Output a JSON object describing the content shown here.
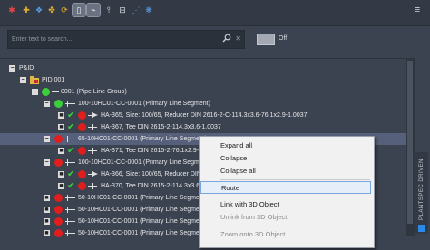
{
  "toolbar": {
    "buttons": [
      {
        "name": "tree-filter-button-1",
        "icon": "funnel-red-icon",
        "color": "#e64545"
      },
      {
        "name": "tree-filter-button-2",
        "icon": "nodes-colored-icon",
        "color": "#e0b030"
      },
      {
        "name": "tree-filter-button-3",
        "icon": "hierarchy-icon",
        "color": "#5aa0e8"
      },
      {
        "name": "tree-filter-button-4",
        "icon": "node-link-icon",
        "color": "#e0b030"
      },
      {
        "name": "refresh-button",
        "icon": "refresh-icon",
        "color": "#e0b030"
      },
      {
        "name": "view-mode-button-1",
        "icon": "column-icon",
        "color": "#d8dbe0"
      },
      {
        "name": "view-mode-button-2",
        "icon": "line-icon",
        "color": "#d8dbe0"
      },
      {
        "name": "pin-button",
        "icon": "pin-icon",
        "color": "#d8dbe0"
      },
      {
        "name": "expand-tree-button",
        "icon": "tree-expand-icon",
        "color": "#d8dbe0"
      },
      {
        "name": "share-button",
        "icon": "share-icon",
        "color": "#5aa0e8"
      },
      {
        "name": "network-button",
        "icon": "network-icon",
        "color": "#5aa0e8"
      }
    ],
    "menu_glyph": "≡"
  },
  "search": {
    "placeholder": "Enter text to search...",
    "value": "",
    "clear_glyph": "✕"
  },
  "toggle": {
    "label": "Off"
  },
  "tree": {
    "rows": [
      {
        "label": "P&ID",
        "expander": "−",
        "icon": "none"
      },
      {
        "label": "PID 001",
        "expander": "−",
        "icon": "folder-icon"
      },
      {
        "label": "0001 (Pipe Line Group)",
        "expander": "−",
        "icon": "green-dot"
      },
      {
        "label": "100-10HC01-CC-0001 (Primary Line Segment)",
        "expander": "−",
        "icon": "green-dot"
      },
      {
        "label": "HA-365, Size: 100/65, Reducer DIN 2616-2-C-114.3x3.6-76.1x2.9-1.0037",
        "expander": "■",
        "icon": "check-red"
      },
      {
        "label": "HA-367, Tee DIN 2615-2-114.3x3.6-1.0037",
        "expander": "■",
        "icon": "check-red"
      },
      {
        "label": "65-10HC01-CC-0001 (Primary Line Segment)",
        "expander": "−",
        "icon": "red-dot",
        "selected": true
      },
      {
        "label": "HA-371, Tee DIN 2615-2-76.1x2.9-1.0037",
        "expander": "■",
        "icon": "check-red"
      },
      {
        "label": "100-10HC01-CC-0001 (Primary Line Segment)",
        "expander": "−",
        "icon": "red-dot"
      },
      {
        "label": "HA-366, Size: 100/65, Reducer DIN 2616-2-C-114.3x3.6-76.1x2.9-1.0037",
        "expander": "■",
        "icon": "check-red"
      },
      {
        "label": "HA-370, Tee DIN 2615-2-114.3x3.6-1.0037",
        "expander": "■",
        "icon": "check-red"
      },
      {
        "label": "50-10HC01-CC-0001 (Primary Line Segment)",
        "expander": "■",
        "icon": "red-dot"
      },
      {
        "label": "50-10HC01-CC-0001 (Primary Line Segment)",
        "expander": "■",
        "icon": "red-dot"
      },
      {
        "label": "50-10HC01-CC-0001 (Primary Line Segment)",
        "expander": "■",
        "icon": "red-dot"
      },
      {
        "label": "50-10HC01-CC-0001 (Primary Line Segment)",
        "expander": "■",
        "icon": "red-dot"
      }
    ]
  },
  "side_tab": {
    "label": "PLANTSPEC DRIVEN"
  },
  "context_menu": {
    "items": [
      {
        "label": "Expand all",
        "disabled": false
      },
      {
        "label": "Collapse",
        "disabled": false
      },
      {
        "label": "Collapse all",
        "disabled": false
      },
      {
        "label": "Route",
        "disabled": false,
        "highlighted": true
      },
      {
        "label": "Link with 3D Object",
        "disabled": false
      },
      {
        "label": "Unlink from 3D Object",
        "disabled": true
      },
      {
        "label": "Zoom onto 3D Object",
        "disabled": true
      }
    ]
  }
}
